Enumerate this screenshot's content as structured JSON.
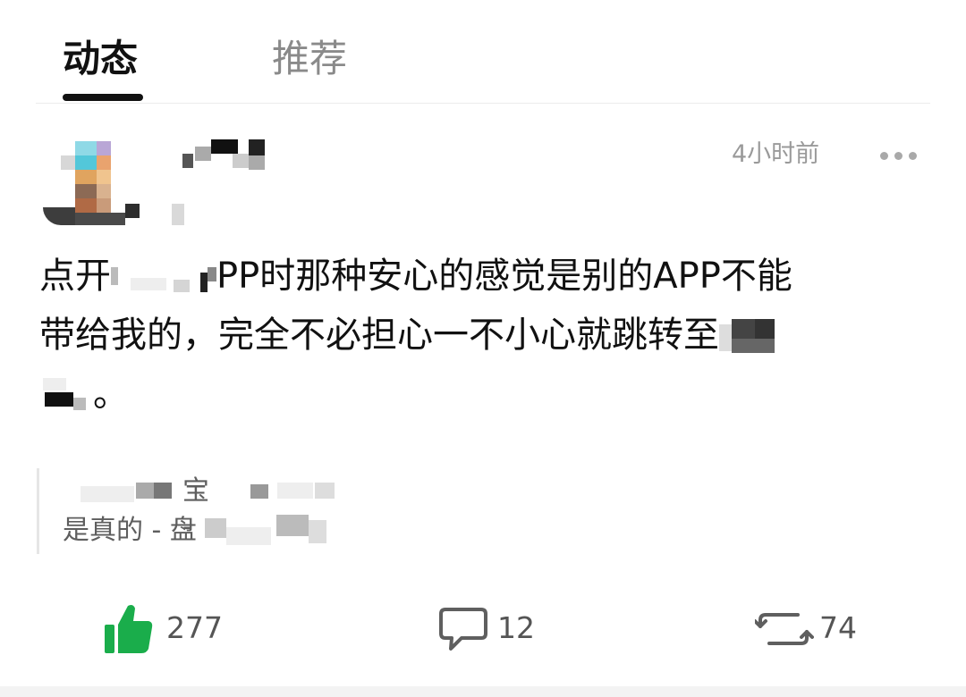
{
  "tabs": [
    {
      "label": "动态",
      "active": true
    },
    {
      "label": "推荐",
      "active": false
    }
  ],
  "post": {
    "timestamp": "4小时前",
    "content": {
      "line1_a": "点开",
      "line1_b": "PP时那种安心的感觉是别的APP不能",
      "line2": "带给我的，完全不必担心一不小心就跳转至",
      "line3_end": "。"
    },
    "quote": {
      "line1_visible": "宝 -",
      "line2_visible": "是真的 - 盘"
    },
    "actions": {
      "likes": "277",
      "comments": "12",
      "reposts": "74"
    }
  },
  "colors": {
    "like_green": "#1aad4b",
    "icon_gray": "#5f5f5f",
    "text_gray": "#9a9a9a"
  }
}
